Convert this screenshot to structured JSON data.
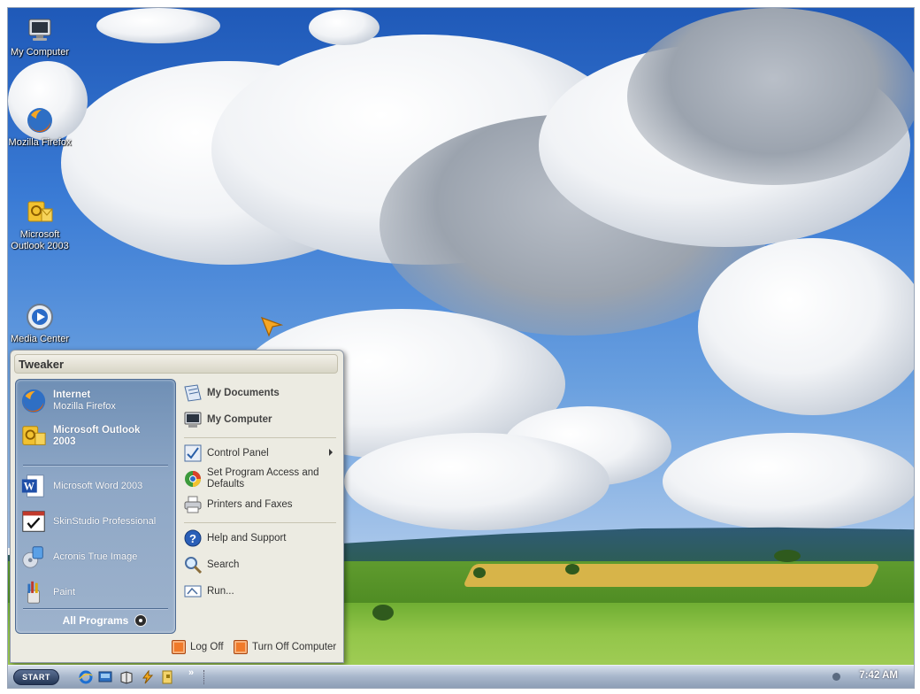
{
  "desktop": {
    "icons": [
      {
        "label": "My Computer",
        "icon": "monitor-icon"
      },
      {
        "label": "Mozilla Firefox",
        "icon": "firefox-icon"
      },
      {
        "label": "Microsoft Outlook 2003",
        "line1": "Microsoft",
        "line2": "Outlook 2003",
        "icon": "outlook-icon"
      },
      {
        "label": "Media Center",
        "icon": "media-center-icon"
      }
    ]
  },
  "start_menu": {
    "header": "Tweaker",
    "pinned": [
      {
        "title": "Internet",
        "subtitle": "Mozilla Firefox",
        "icon": "firefox-icon"
      },
      {
        "title": "Microsoft Outlook",
        "title2": "2003",
        "icon": "outlook-icon"
      }
    ],
    "recent": [
      {
        "label": "Microsoft Word 2003",
        "icon": "word-icon"
      },
      {
        "label": "SkinStudio Professional",
        "icon": "skinstudio-icon"
      },
      {
        "label": "Acronis True Image",
        "icon": "acronis-icon"
      },
      {
        "label": "Paint",
        "icon": "paint-icon"
      }
    ],
    "all_programs": "All Programs",
    "right": {
      "my_documents": "My Documents",
      "my_computer": "My Computer",
      "control_panel": "Control Panel",
      "set_program_access": "Set Program Access and",
      "set_program_access2": "Defaults",
      "printers": "Printers and Faxes",
      "help": "Help and Support",
      "search": "Search",
      "run": "Run..."
    },
    "footer": {
      "log_off": "Log Off",
      "turn_off": "Turn Off Computer"
    }
  },
  "taskbar": {
    "start_label": "START",
    "chevron": "»",
    "clock": "7:42 AM"
  },
  "colors": {
    "start_menu_bg": "#ecebe2",
    "left_pane": "#8ea7c6",
    "footer_button": "#f07a2a"
  }
}
